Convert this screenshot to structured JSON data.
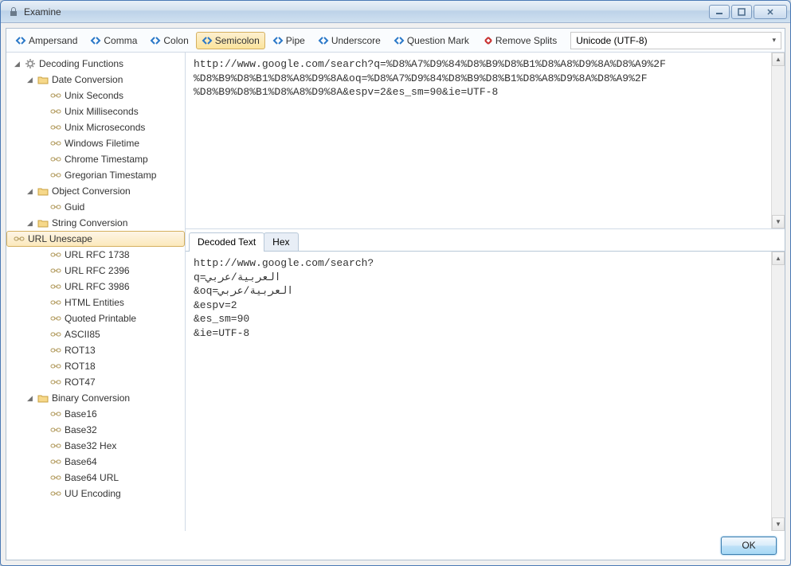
{
  "window": {
    "title": "Examine"
  },
  "toolbar": {
    "splits": [
      {
        "label": "Ampersand",
        "active": false
      },
      {
        "label": "Comma",
        "active": false
      },
      {
        "label": "Colon",
        "active": false
      },
      {
        "label": "Semicolon",
        "active": true
      },
      {
        "label": "Pipe",
        "active": false
      },
      {
        "label": "Underscore",
        "active": false
      },
      {
        "label": "Question Mark",
        "active": false
      }
    ],
    "remove_splits": "Remove Splits",
    "encoding": "Unicode (UTF-8)"
  },
  "tree": {
    "root": "Decoding Functions",
    "groups": [
      {
        "label": "Date Conversion",
        "items": [
          "Unix Seconds",
          "Unix Milliseconds",
          "Unix Microseconds",
          "Windows Filetime",
          "Chrome Timestamp",
          "Gregorian Timestamp"
        ]
      },
      {
        "label": "Object Conversion",
        "items": [
          "Guid"
        ]
      },
      {
        "label": "String Conversion",
        "items": [
          "URL Unescape",
          "URL RFC 1738",
          "URL RFC 2396",
          "URL RFC 3986",
          "HTML Entities",
          "Quoted Printable",
          "ASCII85",
          "ROT13",
          "ROT18",
          "ROT47"
        ],
        "selected": "URL Unescape"
      },
      {
        "label": "Binary Conversion",
        "items": [
          "Base16",
          "Base32",
          "Base32 Hex",
          "Base64",
          "Base64 URL",
          "UU Encoding"
        ]
      }
    ]
  },
  "input": {
    "lines": [
      "http://www.google.com/search?q=%D8%A7%D9%84%D8%B9%D8%B1%D8%A8%D9%8A%D8%A9%2F",
      "%D8%B9%D8%B1%D8%A8%D9%8A&oq=%D8%A7%D9%84%D8%B9%D8%B1%D8%A8%D9%8A%D8%A9%2F",
      "%D8%B9%D8%B1%D8%A8%D9%8A&espv=2&es_sm=90&ie=UTF-8"
    ]
  },
  "tabs": {
    "decoded": "Decoded Text",
    "hex": "Hex",
    "active": "decoded"
  },
  "output": {
    "lines": [
      "http://www.google.com/search?",
      "q=العربية/عربي",
      "&oq=العربية/عربي",
      "&espv=2",
      "&es_sm=90",
      "&ie=UTF-8"
    ]
  },
  "buttons": {
    "ok": "OK"
  }
}
